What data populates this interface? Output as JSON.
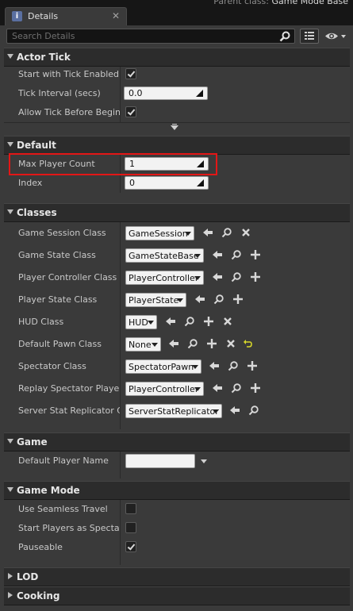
{
  "window": {
    "parent_class_label": "Parent class:",
    "parent_class_value": "Game Mode Base"
  },
  "tab": {
    "icon_letter": "i",
    "label": "Details",
    "close": "✕"
  },
  "search": {
    "placeholder": "Search Details"
  },
  "sections": {
    "actor_tick": {
      "title": "Actor Tick",
      "start_with_tick_enabled": {
        "label": "Start with Tick Enabled",
        "checked": true
      },
      "tick_interval": {
        "label": "Tick Interval (secs)",
        "value": "0.0"
      },
      "allow_tick_before_begin_play": {
        "label": "Allow Tick Before Begin Play",
        "checked": true
      }
    },
    "default": {
      "title": "Default",
      "max_player_count": {
        "label": "Max Player Count",
        "value": "1"
      },
      "index": {
        "label": "Index",
        "value": "0"
      }
    },
    "classes": {
      "title": "Classes",
      "rows": [
        {
          "label": "Game Session Class",
          "value": "GameSession"
        },
        {
          "label": "Game State Class",
          "value": "GameStateBase"
        },
        {
          "label": "Player Controller Class",
          "value": "PlayerController"
        },
        {
          "label": "Player State Class",
          "value": "PlayerState"
        },
        {
          "label": "HUD Class",
          "value": "HUD"
        },
        {
          "label": "Default Pawn Class",
          "value": "None"
        },
        {
          "label": "Spectator Class",
          "value": "SpectatorPawn"
        },
        {
          "label": "Replay Spectator Player Controller Class",
          "value": "PlayerController"
        },
        {
          "label": "Server Stat Replicator Class",
          "value": "ServerStatReplicator"
        }
      ]
    },
    "game": {
      "title": "Game",
      "default_player_name": {
        "label": "Default Player Name",
        "value": ""
      }
    },
    "game_mode": {
      "title": "Game Mode",
      "use_seamless_travel": {
        "label": "Use Seamless Travel",
        "checked": false
      },
      "start_players_as_spectators": {
        "label": "Start Players as Spectators",
        "checked": false
      },
      "pauseable": {
        "label": "Pauseable",
        "checked": true
      }
    },
    "lod": {
      "title": "LOD"
    },
    "cooking": {
      "title": "Cooking"
    }
  },
  "colors": {
    "highlight": "#e31616",
    "panel": "#3a3a3a",
    "header": "#2c2c2c"
  }
}
